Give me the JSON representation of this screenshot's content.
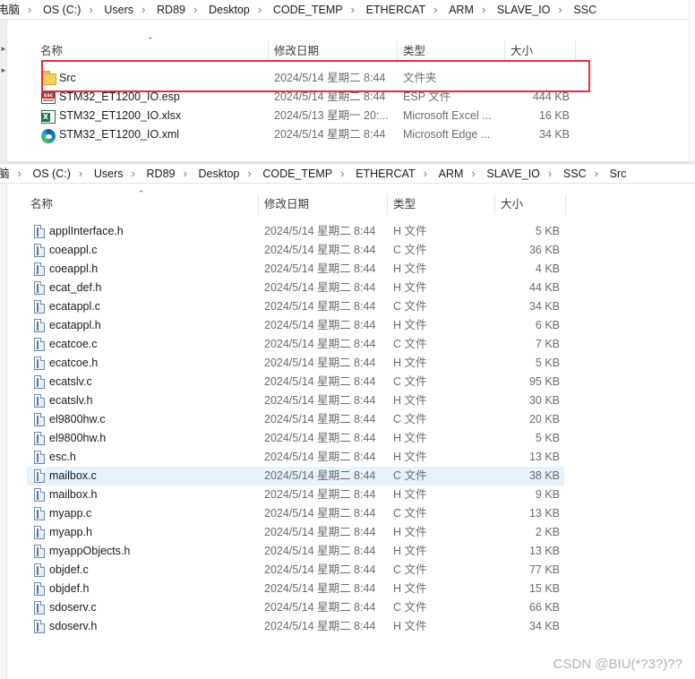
{
  "top_pane": {
    "breadcrumb": [
      "电脑",
      "OS (C:)",
      "Users",
      "RD89",
      "Desktop",
      "CODE_TEMP",
      "ETHERCAT",
      "ARM",
      "SLAVE_IO",
      "SSC"
    ],
    "columns": {
      "name": "名称",
      "date": "修改日期",
      "type": "类型",
      "size": "大小"
    },
    "rows": [
      {
        "icon": "folder-icon",
        "name": "Src",
        "date": "2024/5/14 星期二 8:44",
        "type": "文件夹",
        "size": ""
      },
      {
        "icon": "esp-file-icon",
        "name": "STM32_ET1200_IO.esp",
        "date": "2024/5/14 星期二 8:44",
        "type": "ESP 文件",
        "size": "444 KB"
      },
      {
        "icon": "excel-file-icon",
        "name": "STM32_ET1200_IO.xlsx",
        "date": "2024/5/13 星期一 20:...",
        "type": "Microsoft Excel ...",
        "size": "16 KB"
      },
      {
        "icon": "edge-file-icon",
        "name": "STM32_ET1200_IO.xml",
        "date": "2024/5/14 星期二 8:44",
        "type": "Microsoft Edge ...",
        "size": "34 KB"
      }
    ]
  },
  "bottom_pane": {
    "breadcrumb": [
      "脑",
      "OS (C:)",
      "Users",
      "RD89",
      "Desktop",
      "CODE_TEMP",
      "ETHERCAT",
      "ARM",
      "SLAVE_IO",
      "SSC",
      "Src"
    ],
    "columns": {
      "name": "名称",
      "date": "修改日期",
      "type": "类型",
      "size": "大小"
    },
    "selected_row": "mailbox.c",
    "rows": [
      {
        "name": "applInterface.h",
        "date": "2024/5/14 星期二 8:44",
        "type": "H 文件",
        "size": "5 KB"
      },
      {
        "name": "coeappl.c",
        "date": "2024/5/14 星期二 8:44",
        "type": "C 文件",
        "size": "36 KB"
      },
      {
        "name": "coeappl.h",
        "date": "2024/5/14 星期二 8:44",
        "type": "H 文件",
        "size": "4 KB"
      },
      {
        "name": "ecat_def.h",
        "date": "2024/5/14 星期二 8:44",
        "type": "H 文件",
        "size": "44 KB"
      },
      {
        "name": "ecatappl.c",
        "date": "2024/5/14 星期二 8:44",
        "type": "C 文件",
        "size": "34 KB"
      },
      {
        "name": "ecatappl.h",
        "date": "2024/5/14 星期二 8:44",
        "type": "H 文件",
        "size": "6 KB"
      },
      {
        "name": "ecatcoe.c",
        "date": "2024/5/14 星期二 8:44",
        "type": "C 文件",
        "size": "7 KB"
      },
      {
        "name": "ecatcoe.h",
        "date": "2024/5/14 星期二 8:44",
        "type": "H 文件",
        "size": "5 KB"
      },
      {
        "name": "ecatslv.c",
        "date": "2024/5/14 星期二 8:44",
        "type": "C 文件",
        "size": "95 KB"
      },
      {
        "name": "ecatslv.h",
        "date": "2024/5/14 星期二 8:44",
        "type": "H 文件",
        "size": "30 KB"
      },
      {
        "name": "el9800hw.c",
        "date": "2024/5/14 星期二 8:44",
        "type": "C 文件",
        "size": "20 KB"
      },
      {
        "name": "el9800hw.h",
        "date": "2024/5/14 星期二 8:44",
        "type": "H 文件",
        "size": "5 KB"
      },
      {
        "name": "esc.h",
        "date": "2024/5/14 星期二 8:44",
        "type": "H 文件",
        "size": "13 KB"
      },
      {
        "name": "mailbox.c",
        "date": "2024/5/14 星期二 8:44",
        "type": "C 文件",
        "size": "38 KB"
      },
      {
        "name": "mailbox.h",
        "date": "2024/5/14 星期二 8:44",
        "type": "H 文件",
        "size": "9 KB"
      },
      {
        "name": "myapp.c",
        "date": "2024/5/14 星期二 8:44",
        "type": "C 文件",
        "size": "13 KB"
      },
      {
        "name": "myapp.h",
        "date": "2024/5/14 星期二 8:44",
        "type": "H 文件",
        "size": "2 KB"
      },
      {
        "name": "myappObjects.h",
        "date": "2024/5/14 星期二 8:44",
        "type": "H 文件",
        "size": "13 KB"
      },
      {
        "name": "objdef.c",
        "date": "2024/5/14 星期二 8:44",
        "type": "C 文件",
        "size": "77 KB"
      },
      {
        "name": "objdef.h",
        "date": "2024/5/14 星期二 8:44",
        "type": "H 文件",
        "size": "15 KB"
      },
      {
        "name": "sdoserv.c",
        "date": "2024/5/14 星期二 8:44",
        "type": "C 文件",
        "size": "66 KB"
      },
      {
        "name": "sdoserv.h",
        "date": "2024/5/14 星期二 8:44",
        "type": "H 文件",
        "size": "34 KB"
      }
    ]
  },
  "highlight_color": "#e0303a",
  "selection_color": "#e5f1fb",
  "watermark": "CSDN @BIU(*?3?)??"
}
